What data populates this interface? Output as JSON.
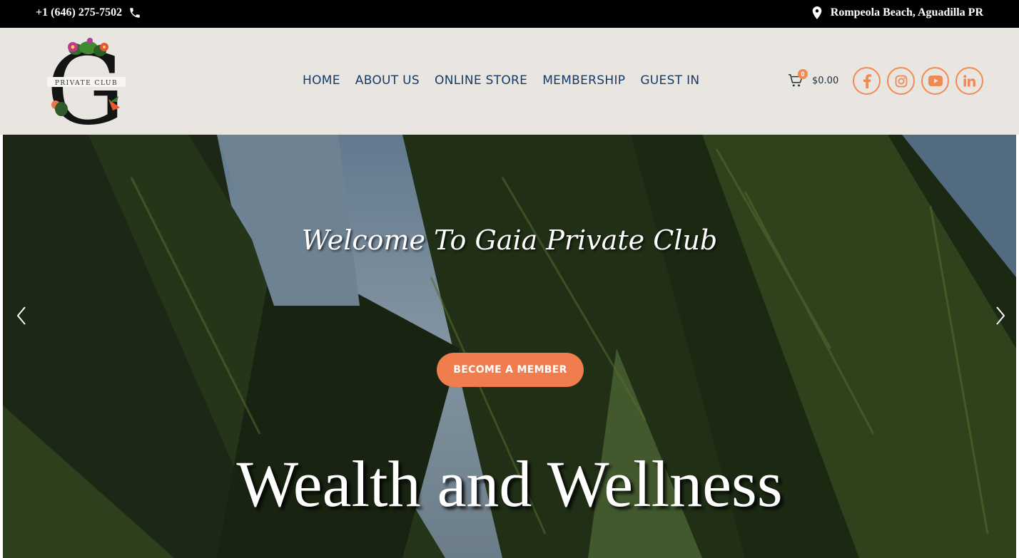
{
  "topbar": {
    "phone": "+1 (646) 275-7502",
    "location": "Rompeola Beach, Aguadilla PR"
  },
  "logo": {
    "letter": "G",
    "text": "PRIVATE CLUB"
  },
  "nav": {
    "items": [
      {
        "label": "HOME"
      },
      {
        "label": "ABOUT US"
      },
      {
        "label": "ONLINE STORE"
      },
      {
        "label": "MEMBERSHIP"
      },
      {
        "label": "GUEST IN"
      }
    ]
  },
  "cart": {
    "count": "0",
    "total": "$0.00"
  },
  "socials": [
    "facebook-icon",
    "instagram-icon",
    "youtube-icon",
    "linkedin-icon"
  ],
  "hero": {
    "welcome": "Welcome To Gaia Private Club",
    "cta": "BECOME A MEMBER",
    "headline": "Wealth and Wellness"
  },
  "colors": {
    "accent": "#ef7d4e",
    "nav": "#163a66",
    "header_bg": "#e9e6e2"
  }
}
